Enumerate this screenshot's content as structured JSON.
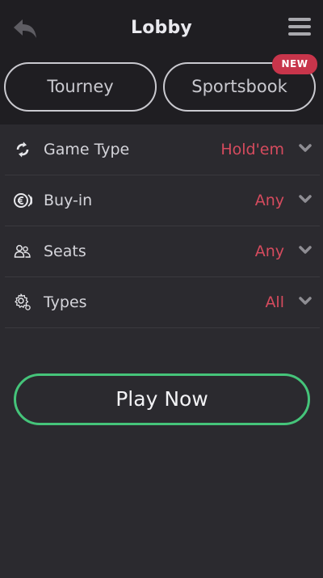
{
  "header": {
    "title": "Lobby",
    "back_icon": "back-arrow-icon",
    "menu_icon": "hamburger-menu-icon"
  },
  "tabs": [
    {
      "label": "Tourney"
    },
    {
      "label": "Sportsbook",
      "badge": "NEW"
    }
  ],
  "filters": [
    {
      "label": "Game Type",
      "value": "Hold'em",
      "icon": "refresh-icon"
    },
    {
      "label": "Buy-in",
      "value": "Any",
      "icon": "euro-chip-icon"
    },
    {
      "label": "Seats",
      "value": "Any",
      "icon": "people-icon"
    },
    {
      "label": "Types",
      "value": "All",
      "icon": "gear-icon"
    }
  ],
  "play_button": {
    "label": "Play Now"
  },
  "colors": {
    "background": "#2b2a2f",
    "header": "#1f1e22",
    "accent_value": "#d64b5e",
    "badge": "#c8354b",
    "play_border": "#45c47a"
  }
}
